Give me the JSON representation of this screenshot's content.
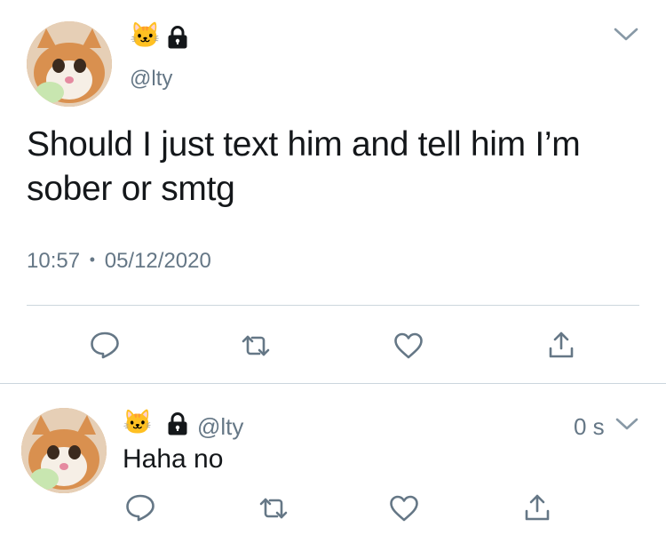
{
  "main_tweet": {
    "name_emoji": "🐱",
    "handle": "@lty",
    "text": "Should I just text him and tell him I’m sober or smtg",
    "time": "10:57",
    "separator": "•",
    "date": "05/12/2020"
  },
  "reply": {
    "name_emoji": "🐱",
    "handle": "@lty",
    "time_ago": "0 s",
    "text": "Haha no"
  },
  "colors": {
    "text": "#14171a",
    "secondary": "#657786",
    "icon": "#657786",
    "divider": "#ccd6dd"
  },
  "icons": [
    "chevron-down-icon",
    "lock-icon",
    "reply-icon",
    "retweet-icon",
    "like-icon",
    "share-icon"
  ]
}
